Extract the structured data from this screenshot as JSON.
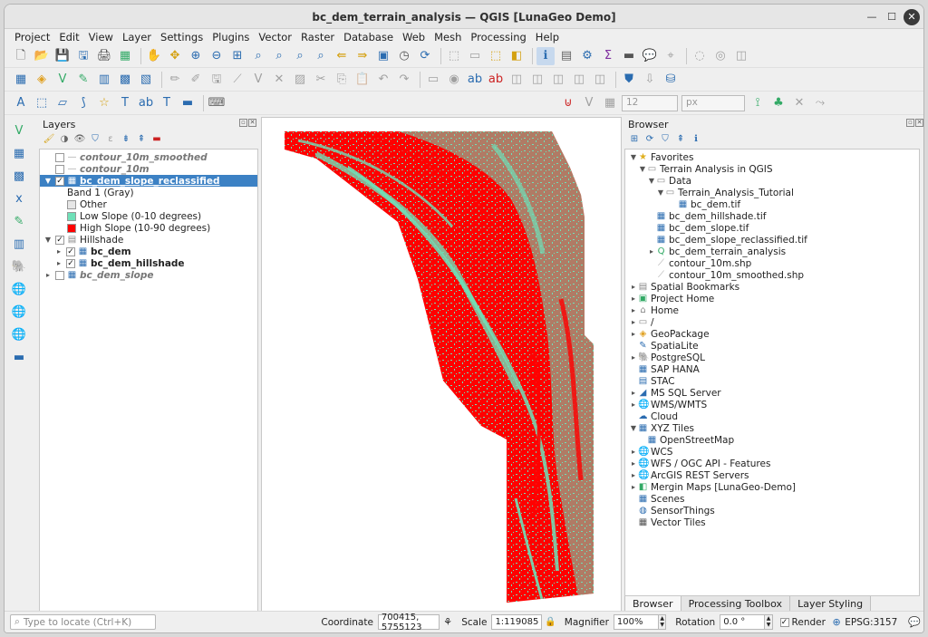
{
  "window": {
    "title": "bc_dem_terrain_analysis — QGIS [LunaGeo Demo]"
  },
  "menu": [
    "Project",
    "Edit",
    "View",
    "Layer",
    "Settings",
    "Plugins",
    "Vector",
    "Raster",
    "Database",
    "Web",
    "Mesh",
    "Processing",
    "Help"
  ],
  "toolbar3": {
    "size_value": "12",
    "size_unit": "px"
  },
  "layers_panel": {
    "title": "Layers",
    "items": [
      {
        "label": "contour_10m_smoothed",
        "checked": false
      },
      {
        "label": "contour_10m",
        "checked": false
      },
      {
        "label": "bc_dem_slope_reclassified",
        "checked": true,
        "selected": true
      },
      {
        "label": "Band 1 (Gray)"
      },
      {
        "label": "Other",
        "color": "#e6e6e6"
      },
      {
        "label": "Low Slope (0-10 degrees)",
        "color": "#6fe0b8"
      },
      {
        "label": "High Slope (10-90 degrees)",
        "color": "#ff0000"
      },
      {
        "label": "Hillshade",
        "checked": true
      },
      {
        "label": "bc_dem",
        "checked": true
      },
      {
        "label": "bc_dem_hillshade",
        "checked": true
      },
      {
        "label": "bc_dem_slope",
        "checked": false
      }
    ]
  },
  "browser_panel": {
    "title": "Browser",
    "items": [
      "Favorites",
      "Terrain Analysis in QGIS",
      "Data",
      "Terrain_Analysis_Tutorial",
      "bc_dem.tif",
      "bc_dem_hillshade.tif",
      "bc_dem_slope.tif",
      "bc_dem_slope_reclassified.tif",
      "bc_dem_terrain_analysis",
      "contour_10m.shp",
      "contour_10m_smoothed.shp",
      "Spatial Bookmarks",
      "Project Home",
      "Home",
      "/",
      "GeoPackage",
      "SpatiaLite",
      "PostgreSQL",
      "SAP HANA",
      "STAC",
      "MS SQL Server",
      "WMS/WMTS",
      "Cloud",
      "XYZ Tiles",
      "OpenStreetMap",
      "WCS",
      "WFS / OGC API - Features",
      "ArcGIS REST Servers",
      "Mergin Maps [LunaGeo-Demo]",
      "Scenes",
      "SensorThings",
      "Vector Tiles"
    ],
    "tabs": [
      "Browser",
      "Processing Toolbox",
      "Layer Styling"
    ]
  },
  "map": {
    "low_color": "#6fe0b8",
    "high_color": "#ff0000"
  },
  "statusbar": {
    "locator_placeholder": "Type to locate (Ctrl+K)",
    "coordinate_label": "Coordinate",
    "coordinate_value": "700415, 5755123",
    "scale_label": "Scale",
    "scale_value": "1:119085",
    "magnifier_label": "Magnifier",
    "magnifier_value": "100%",
    "rotation_label": "Rotation",
    "rotation_value": "0.0 °",
    "render_label": "Render",
    "crs": "EPSG:3157"
  }
}
